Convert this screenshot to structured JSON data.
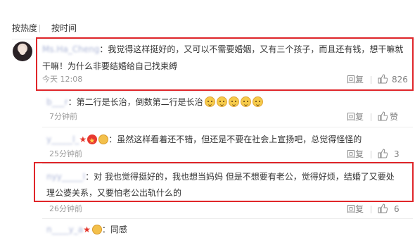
{
  "sort": {
    "hot_label": "按热度",
    "time_label": "按时间"
  },
  "colors": {
    "highlight_border": "#e0262a",
    "username": "#aab4d6",
    "text": "#333333",
    "meta": "#9a9a9a"
  },
  "comments": [
    {
      "username": "Ms.Ha_Cheng",
      "text_line1": "：我觉得这样挺好的，又可以不需要婚姻，又有三个孩子，而且还有钱，想干嘛就",
      "text_line2": "干嘛！为什么非要结婚给自己找束缚",
      "time": "今天 12:08",
      "reply_label": "回复",
      "like_count": "826",
      "icons": [
        "avatar",
        "like-thumb-icon"
      ]
    }
  ],
  "replies": [
    {
      "username": "b___r",
      "text": "：第二行是长治，倒数第二行是长治",
      "emoji_names": [
        "laugh-emoji",
        "laugh-emoji",
        "laugh-emoji",
        "laugh-emoji",
        "laugh-emoji"
      ],
      "time": "7分钟前",
      "reply_label": "回复",
      "like_label": "赞"
    },
    {
      "username": "y_____l_",
      "text": "：虽然这样看着还不错，但还是不要在社会上宣扬吧，总觉得怪怪的",
      "badges": [
        "red-star-icon",
        "gold-medal-icon",
        "lion-icon"
      ],
      "time": "25分钟前",
      "reply_label": "回复",
      "like_count": "3"
    },
    {
      "username": "nyy_____l",
      "text_line1": "：对 我也觉得挺好的，我也想当妈妈 但是不想要有老公，觉得好烦，结婚了又要处",
      "text_line2": "理公婆关系，又要怕老公出轨什么的",
      "time": "26分钟前",
      "reply_label": "回复",
      "like_count": "6"
    },
    {
      "username": "n____y_a",
      "text": "：同感",
      "badges": [
        "red-star-icon",
        "vip-icon"
      ]
    }
  ]
}
